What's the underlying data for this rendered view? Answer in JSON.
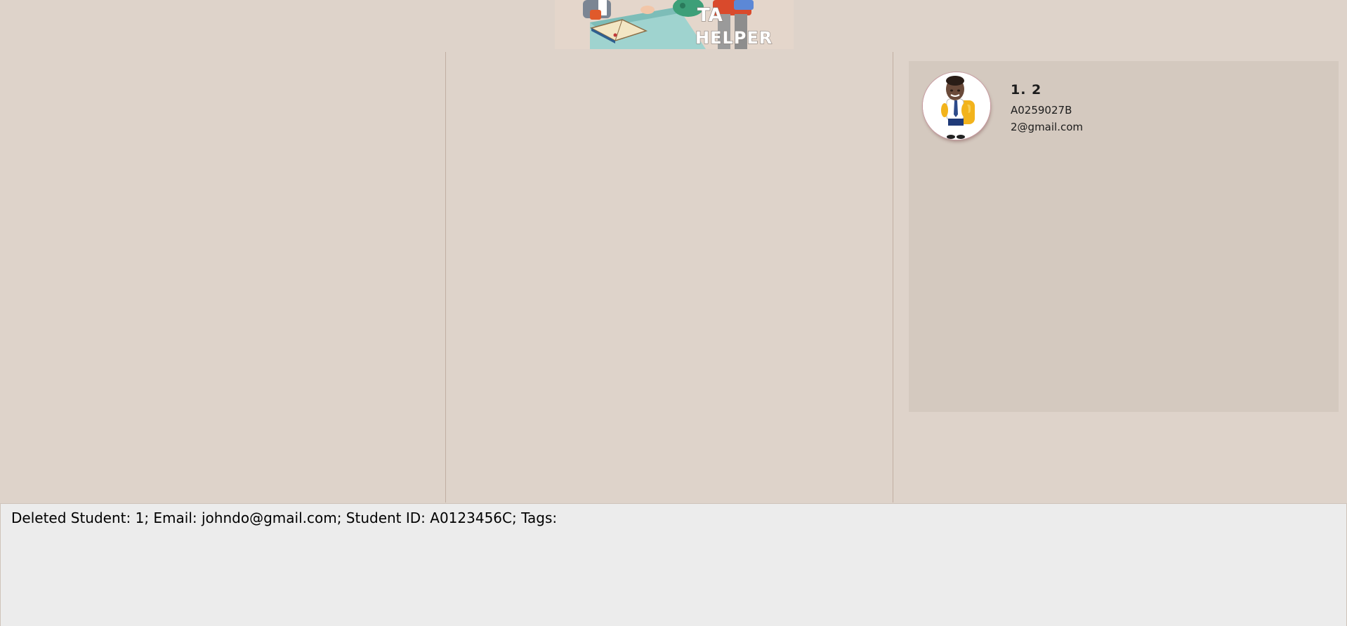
{
  "header": {
    "logo_text_line1": "TA",
    "logo_text_line2": "HELPER"
  },
  "students": [
    {
      "name": "1. 2",
      "student_id": "A0259027B",
      "email": "2@gmail.com",
      "avatar_icon": "student-avatar-icon"
    }
  ],
  "result_display": {
    "text": "Deleted Student: 1; Email: johndo@gmail.com; Student ID: A0123456C; Tags:"
  },
  "colors": {
    "background": "#ded3ca",
    "card_background": "#d4c9bf",
    "divider": "#c1aea2",
    "result_background": "#ececec"
  }
}
